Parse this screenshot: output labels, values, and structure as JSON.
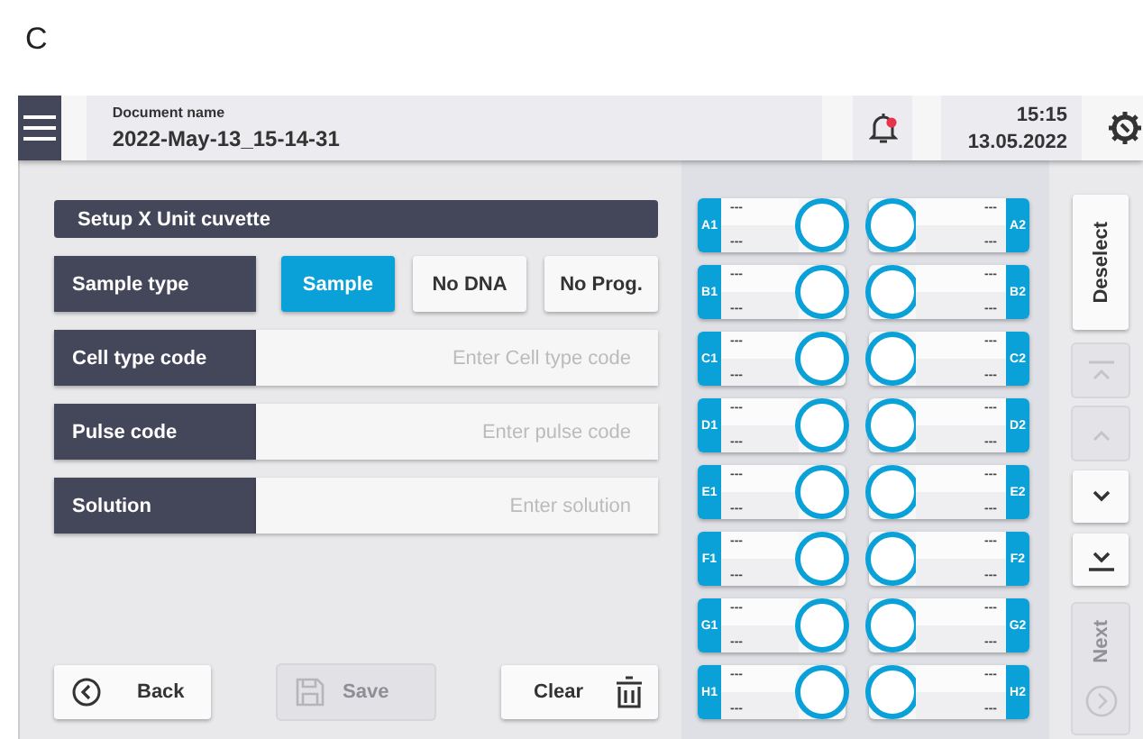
{
  "figure_label": "C",
  "header": {
    "doc_caption": "Document name",
    "doc_name": "2022-May-13_15-14-31",
    "notification": true,
    "time": "15:15",
    "date": "13.05.2022"
  },
  "setup": {
    "title": "Setup X Unit cuvette",
    "sample_type": {
      "label": "Sample type",
      "options": [
        {
          "label": "Sample",
          "selected": true
        },
        {
          "label": "No DNA",
          "selected": false
        },
        {
          "label": "No Prog.",
          "selected": false
        }
      ]
    },
    "fields": [
      {
        "label": "Cell type code",
        "placeholder": "Enter Cell type code"
      },
      {
        "label": "Pulse code",
        "placeholder": "Enter pulse code"
      },
      {
        "label": "Solution",
        "placeholder": "Enter solution"
      }
    ],
    "buttons": [
      {
        "kind": "back",
        "label": "Back",
        "disabled": false
      },
      {
        "kind": "save",
        "label": "Save",
        "disabled": true
      },
      {
        "kind": "clear",
        "label": "Clear",
        "disabled": false
      }
    ]
  },
  "wells": [
    {
      "left": {
        "label": "A1",
        "line_1": "---",
        "line_2": "---"
      },
      "right": {
        "label": "A2",
        "line_1": "---",
        "line_2": "---"
      }
    },
    {
      "left": {
        "label": "B1",
        "line_1": "---",
        "line_2": "---"
      },
      "right": {
        "label": "B2",
        "line_1": "---",
        "line_2": "---"
      }
    },
    {
      "left": {
        "label": "C1",
        "line_1": "---",
        "line_2": "---"
      },
      "right": {
        "label": "C2",
        "line_1": "---",
        "line_2": "---"
      }
    },
    {
      "left": {
        "label": "D1",
        "line_1": "---",
        "line_2": "---"
      },
      "right": {
        "label": "D2",
        "line_1": "---",
        "line_2": "---"
      }
    },
    {
      "left": {
        "label": "E1",
        "line_1": "---",
        "line_2": "---"
      },
      "right": {
        "label": "E2",
        "line_1": "---",
        "line_2": "---"
      }
    },
    {
      "left": {
        "label": "F1",
        "line_1": "---",
        "line_2": "---"
      },
      "right": {
        "label": "F2",
        "line_1": "---",
        "line_2": "---"
      }
    },
    {
      "left": {
        "label": "G1",
        "line_1": "---",
        "line_2": "---"
      },
      "right": {
        "label": "G2",
        "line_1": "---",
        "line_2": "---"
      }
    },
    {
      "left": {
        "label": "H1",
        "line_1": "---",
        "line_2": "---"
      },
      "right": {
        "label": "H2",
        "line_1": "---",
        "line_2": "---"
      }
    }
  ],
  "side": {
    "deselect": "Deselect",
    "nav": [
      {
        "kind": "top",
        "disabled": true
      },
      {
        "kind": "up",
        "disabled": true
      },
      {
        "kind": "down",
        "disabled": false
      },
      {
        "kind": "bottom",
        "disabled": false
      }
    ],
    "next": {
      "label": "Next",
      "disabled": true
    }
  }
}
